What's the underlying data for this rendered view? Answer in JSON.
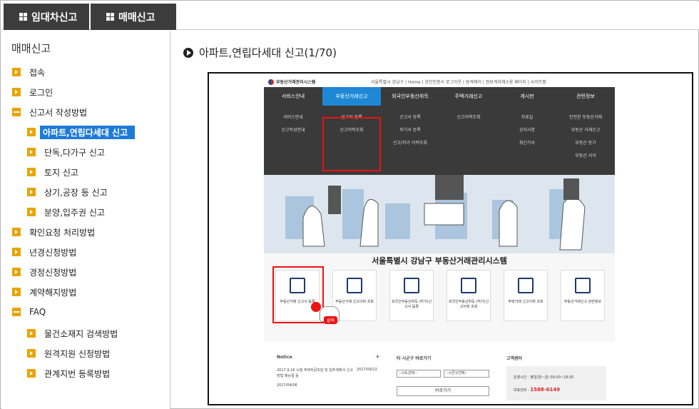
{
  "tabs": [
    {
      "label": "임대차신고"
    },
    {
      "label": "매매신고"
    }
  ],
  "sidebar": {
    "title": "매매신고",
    "items": [
      {
        "label": "접속"
      },
      {
        "label": "로그인"
      },
      {
        "label": "신고서 작성방법"
      },
      {
        "label": "아파트,연립다세대 신고"
      },
      {
        "label": "단독,다가구 신고"
      },
      {
        "label": "토지 신고"
      },
      {
        "label": "상기,공장 등 신고"
      },
      {
        "label": "분양,입주권 신고"
      },
      {
        "label": "확인요청 처리방법"
      },
      {
        "label": "년경신청방법"
      },
      {
        "label": "경정신청방법"
      },
      {
        "label": "계약해지방법"
      },
      {
        "label": "FAQ"
      },
      {
        "label": "물건소재지 검색방법"
      },
      {
        "label": "원격지원 신청방법"
      },
      {
        "label": "관계지번 등록방법"
      }
    ]
  },
  "main": {
    "title": "아파트,연립다세대 신고(1/70)"
  },
  "site": {
    "logo": "부동산거래관리시스템",
    "toplinks": "서울특별시 강남구  |  Home  |  공인인증서 로그아웃  |  원격에어  |  정보격차해소용 페이지  |  사이트맵",
    "nav": [
      "서비스안내",
      "부동산거래신고",
      "외국인부동산취득",
      "주택거래신고",
      "게시판",
      "관련정보"
    ],
    "sub": [
      [
        "서비스안내",
        "신고작성안내"
      ],
      [
        "신고서 등록",
        "신고이력조회"
      ],
      [
        "신고서 등록",
        "후기서 등록",
        "신고/허가 이력조회"
      ],
      [
        "신고이력조회"
      ],
      [
        "자료실",
        "공지사항",
        "최신기사"
      ],
      [
        "안전한 부동산거래",
        "부동산 거래신고",
        "부동산 등기",
        "부동산 서식"
      ]
    ],
    "title": "서울특별시 강남구 부동산거래관리시스템",
    "cards": [
      "부동산거래 신고서 등록",
      "부동산거래 신고이력 조회",
      "외국인부동산취득 (허가)신고서 등록",
      "외국인부동산취득 (허가)신고이력 조회",
      "주택거래 신고이력 조회",
      "부동산거래신고 관련정보"
    ],
    "click_label": "클릭",
    "notice_title": "Notice",
    "notice_plus": "+",
    "notice_text": "2017.9.16 시행 주택자금조달 및 입주계획서 신고방법 매뉴얼 등",
    "notice_date1": "2017/09/22",
    "notice_date2": "2017/04/06",
    "quick_title": "타 시군구 바로가기",
    "select1": "--시도선택--",
    "select2": "--시군구선택--",
    "go_button": "바로가기",
    "cs_title": "고객센터",
    "cs_hours": "운영시간 : 평일(월~금) 09:00~18:00",
    "cs_tel_label": "대표전화 :",
    "cs_tel": "1588-0149"
  }
}
